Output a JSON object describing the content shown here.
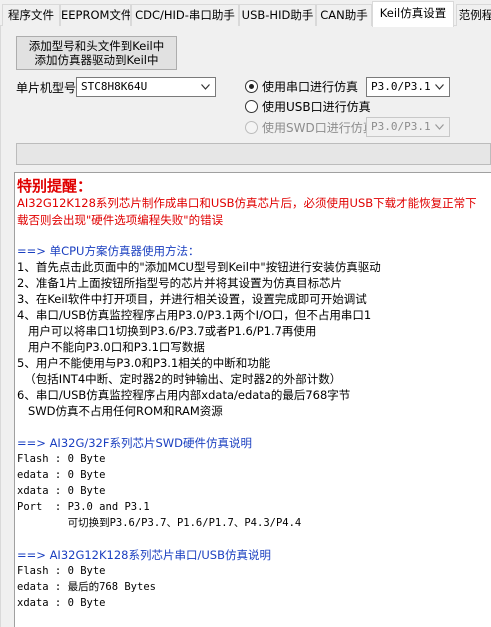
{
  "tabs": [
    {
      "label": "程序文件"
    },
    {
      "label": "EEPROM文件"
    },
    {
      "label": "CDC/HID-串口助手"
    },
    {
      "label": "USB-HID助手"
    },
    {
      "label": "CAN助手"
    },
    {
      "label": "Keil仿真设置",
      "active": true
    },
    {
      "label": "范例程"
    }
  ],
  "add_button": {
    "line1": "添加型号和头文件到Keil中",
    "line2": "添加仿真器驱动到Keil中"
  },
  "mcu": {
    "label": "单片机型号",
    "value": "STC8H8K64U"
  },
  "radios": [
    {
      "label": "使用串口进行仿真",
      "checked": true,
      "disabled": false,
      "port": "P3.0/P3.1"
    },
    {
      "label": "使用USB口进行仿真",
      "checked": false,
      "disabled": false
    },
    {
      "label": "使用SWD口进行仿真",
      "checked": false,
      "disabled": true,
      "port": "P3.0/P3.1"
    }
  ],
  "progress": {
    "value": 0
  },
  "info": {
    "warning_title": "特别提醒：",
    "warning_text": "AI32G12K128系列芯片制作成串口和USB仿真芯片后，必须使用USB下载才能恢复正常下载否则会出现\"硬件选项编程失败\"的错误",
    "lines": [
      {
        "text": "==> 单CPU方案仿真器使用方法：",
        "head": true
      },
      {
        "text": "1、首先点击此页面中的\"添加MCU型号到Keil中\"按钮进行安装仿真驱动"
      },
      {
        "text": "2、准备1片上面按钮所指型号的芯片并将其设置为仿真目标芯片"
      },
      {
        "text": "3、在Keil软件中打开项目，并进行相关设置，设置完成即可开始调试"
      },
      {
        "text": "4、串口/USB仿真监控程序占用P3.0/P3.1两个I/O口，但不占用串口1"
      },
      {
        "text": "   用户可以将串口1切换到P3.6/P3.7或者P1.6/P1.7再使用"
      },
      {
        "text": "   用户不能向P3.0口和P3.1口写数据"
      },
      {
        "text": "5、用户不能使用与P3.0和P3.1相关的中断和功能"
      },
      {
        "text": "  （包括INT4中断、定时器2的时钟输出、定时器2的外部计数）"
      },
      {
        "text": "6、串口/USB仿真监控程序占用内部xdata/edata的最后768字节"
      },
      {
        "text": "   SWD仿真不占用任何ROM和RAM资源"
      },
      {
        "text": ""
      },
      {
        "text": "==> AI32G/32F系列芯片SWD硬件仿真说明",
        "head": true
      },
      {
        "text": "Flash : 0 Byte",
        "mono": true
      },
      {
        "text": "edata : 0 Byte",
        "mono": true
      },
      {
        "text": "xdata : 0 Byte",
        "mono": true
      },
      {
        "text": "Port  : P3.0 and P3.1",
        "mono": true
      },
      {
        "text": "        可切换到P3.6/P3.7、P1.6/P1.7、P4.3/P4.4",
        "mono": true
      },
      {
        "text": ""
      },
      {
        "text": "==> AI32G12K128系列芯片串口/USB仿真说明",
        "head": true
      },
      {
        "text": "Flash : 0 Byte",
        "mono": true
      },
      {
        "text": "edata : 最后的768 Bytes",
        "mono": true
      },
      {
        "text": "xdata : 0 Byte",
        "mono": true
      }
    ]
  }
}
